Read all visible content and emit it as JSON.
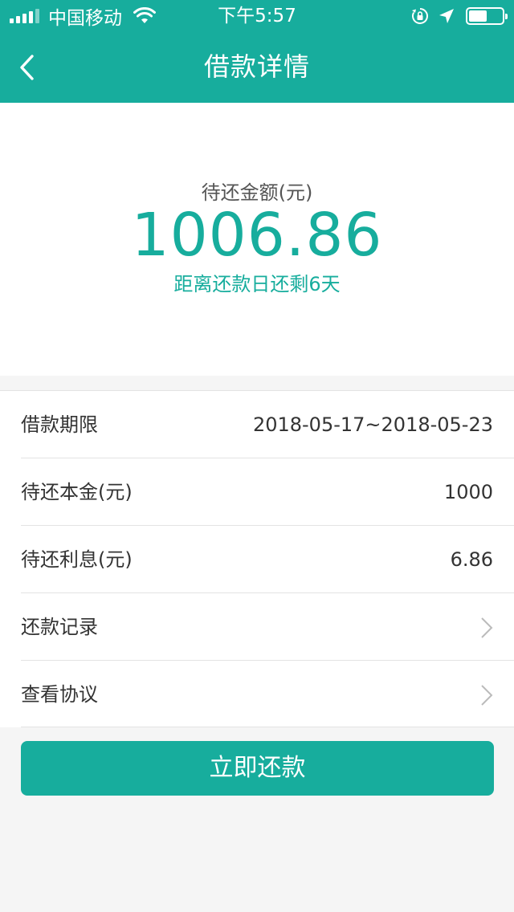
{
  "status_bar": {
    "carrier": "中国移动",
    "time": "下午5:57",
    "battery_level": 0.55
  },
  "nav": {
    "title": "借款详情"
  },
  "summary": {
    "label": "待还金额(元)",
    "amount": "1006.86",
    "countdown": "距离还款日还剩6天"
  },
  "details": [
    {
      "label": "借款期限",
      "value": "2018-05-17~2018-05-23"
    },
    {
      "label": "待还本金(元)",
      "value": "1000"
    },
    {
      "label": "待还利息(元)",
      "value": "6.86"
    },
    {
      "label": "还款记录"
    },
    {
      "label": "查看协议"
    }
  ],
  "action": {
    "pay_label": "立即还款"
  },
  "colors": {
    "accent": "#17ad9d"
  }
}
